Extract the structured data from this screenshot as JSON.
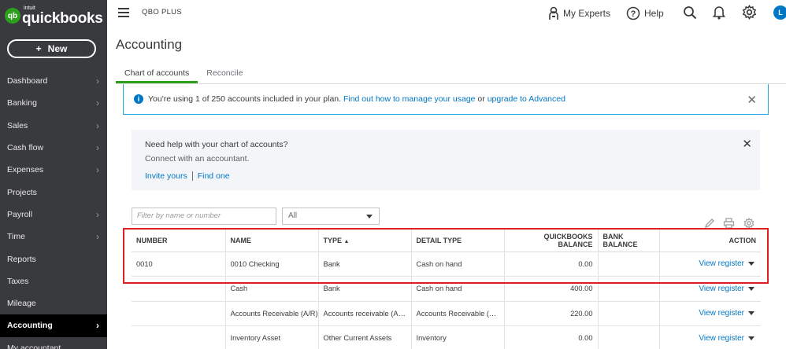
{
  "brand": {
    "badge": "qb",
    "intuit": "intuit",
    "name": "quickbooks"
  },
  "new_button": {
    "plus": "+",
    "label": "New"
  },
  "nav": [
    {
      "label": "Dashboard",
      "chevron": true
    },
    {
      "label": "Banking",
      "chevron": true
    },
    {
      "label": "Sales",
      "chevron": true
    },
    {
      "label": "Cash flow",
      "chevron": true
    },
    {
      "label": "Expenses",
      "chevron": true
    },
    {
      "label": "Projects",
      "chevron": false
    },
    {
      "label": "Payroll",
      "chevron": true
    },
    {
      "label": "Time",
      "chevron": true
    },
    {
      "label": "Reports",
      "chevron": false
    },
    {
      "label": "Taxes",
      "chevron": false
    },
    {
      "label": "Mileage",
      "chevron": false
    },
    {
      "label": "Accounting",
      "chevron": true,
      "active": true
    },
    {
      "label": "My accountant",
      "chevron": false
    }
  ],
  "header": {
    "company": "QBO PLUS",
    "my_experts": "My Experts",
    "help": "Help",
    "avatar_letter": "L"
  },
  "page": {
    "title": "Accounting",
    "tabs": [
      {
        "label": "Chart of accounts",
        "active": true
      },
      {
        "label": "Reconcile",
        "active": false
      }
    ]
  },
  "banner": {
    "text": "You're using 1 of 250 accounts included in your plan.",
    "link1": "Find out how to manage your usage",
    "or": "or",
    "link2": "upgrade to Advanced"
  },
  "help_box": {
    "title": "Need help with your chart of accounts?",
    "subtitle": "Connect with an accountant.",
    "link1": "Invite yours",
    "link2": "Find one"
  },
  "filter": {
    "placeholder": "Filter by name or number",
    "select_value": "All"
  },
  "table": {
    "headers": [
      "NUMBER",
      "NAME",
      "TYPE",
      "DETAIL TYPE",
      "QUICKBOOKS BALANCE",
      "BANK BALANCE",
      "ACTION"
    ],
    "action_label": "View register",
    "rows": [
      {
        "number": "0010",
        "name": "0010 Checking",
        "type": "Bank",
        "detail": "Cash on hand",
        "qb_balance": "0.00",
        "bank_balance": ""
      },
      {
        "number": "",
        "name": "Cash",
        "type": "Bank",
        "detail": "Cash on hand",
        "qb_balance": "400.00",
        "bank_balance": ""
      },
      {
        "number": "",
        "name": "Accounts Receivable (A/R)",
        "type": "Accounts receivable (A…",
        "detail": "Accounts Receivable (…",
        "qb_balance": "220.00",
        "bank_balance": ""
      },
      {
        "number": "",
        "name": "Inventory Asset",
        "type": "Other Current Assets",
        "detail": "Inventory",
        "qb_balance": "0.00",
        "bank_balance": ""
      }
    ]
  },
  "colors": {
    "sidebar": "#393a3d",
    "accent_green": "#2ca01c",
    "link_blue": "#0077c5",
    "highlight_red": "#e02020"
  },
  "icons": [
    "hamburger-icon",
    "experts-icon",
    "help-icon",
    "search-icon",
    "bell-icon",
    "gear-icon",
    "info-icon",
    "close-icon",
    "pencil-icon",
    "print-icon",
    "settings-icon"
  ]
}
